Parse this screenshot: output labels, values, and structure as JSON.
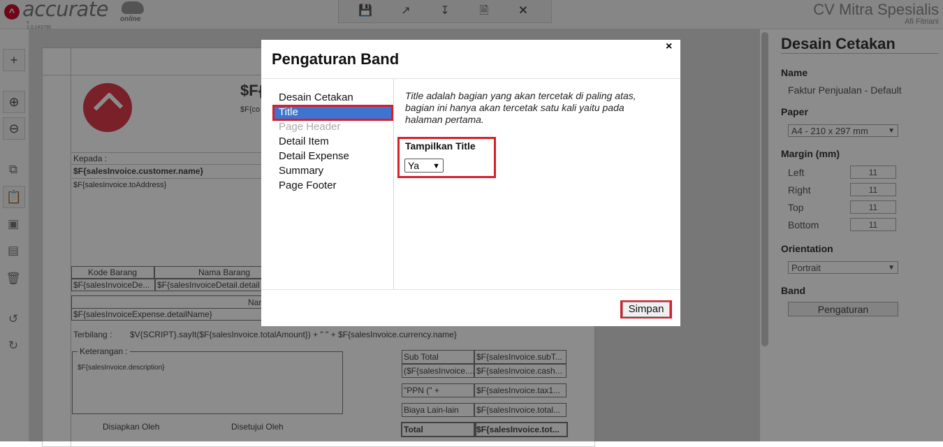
{
  "app": {
    "logo_text": "accurate",
    "logo_sub": "online",
    "version": "v 1.0.1#3790",
    "company": "CV Mitra Spesialis",
    "user": "Afi Fitriani"
  },
  "toolbar_icons": [
    "save-icon",
    "export-icon",
    "download-icon",
    "preview-icon",
    "close-icon"
  ],
  "left_toolbar_icons": [
    "plus-icon",
    "zoom-in-icon",
    "zoom-out-icon",
    "copy-icon",
    "paste-icon",
    "bring-front-icon",
    "send-back-icon",
    "delete-icon",
    "undo-icon",
    "redo-icon"
  ],
  "report": {
    "title_partial": "$F{",
    "subtitle_partial": "$F{co",
    "kepada_label": "Kepada :",
    "customer_name": "$F{salesInvoice.customer.name}",
    "to_address": "$F{salesInvoice.toAddress}",
    "col_kode": "Kode Barang",
    "col_nama": "Nama Barang",
    "cell_kode": "$F{salesInvoiceDe...",
    "cell_nama": "$F{salesInvoiceDetail.detail",
    "expense_header": "Nar",
    "expense_cell": "$F{salesInvoiceExpense.detailName}",
    "terbilang_label": "Terbilang :",
    "terbilang_value": "$V{SCRIPT}.sayIt($F{salesInvoice.totalAmount}) + \" \" + $F{salesInvoice.currency.name}",
    "keterangan_label": "Keterangan :",
    "keterangan_value": "$F{salesInvoice.description}",
    "disiapkan": "Disiapkan Oleh",
    "disetujui": "Disetujui Oleh",
    "summary": [
      {
        "label": "Sub Total",
        "value": "$F{salesInvoice.subT..."
      },
      {
        "label": "($F{salesInvoice....",
        "value": "$F{salesInvoice.cash..."
      },
      {
        "label": "\"PPN (\" +",
        "value": "$F{salesInvoice.tax1..."
      },
      {
        "label": "Biaya Lain-lain",
        "value": "$F{salesInvoice.total..."
      },
      {
        "label": "Total",
        "value": "$F{salesInvoice.tot..."
      }
    ]
  },
  "right_panel": {
    "title": "Desain Cetakan",
    "name_label": "Name",
    "name_value": "Faktur Penjualan - Default",
    "paper_label": "Paper",
    "paper_value": "A4 - 210 x 297 mm",
    "margin_label": "Margin (mm)",
    "margins": [
      {
        "label": "Left",
        "value": "11"
      },
      {
        "label": "Right",
        "value": "11"
      },
      {
        "label": "Top",
        "value": "11"
      },
      {
        "label": "Bottom",
        "value": "11"
      }
    ],
    "orientation_label": "Orientation",
    "orientation_value": "Portrait",
    "band_label": "Band",
    "band_button": "Pengaturan"
  },
  "modal": {
    "title": "Pengaturan Band",
    "close": "×",
    "nav": [
      {
        "label": "Desain Cetakan",
        "state": "normal"
      },
      {
        "label": "Title",
        "state": "selected"
      },
      {
        "label": "Page Header",
        "state": "disabled"
      },
      {
        "label": "Detail Item",
        "state": "normal"
      },
      {
        "label": "Detail Expense",
        "state": "normal"
      },
      {
        "label": "Summary",
        "state": "normal"
      },
      {
        "label": "Page Footer",
        "state": "normal"
      }
    ],
    "description": "Title adalah bagian yang akan tercetak di paling atas, bagian ini hanya akan tercetak satu kali yaitu pada halaman pertama.",
    "field_label": "Tampilkan Title",
    "field_value": "Ya",
    "save_button": "Simpan"
  },
  "colors": {
    "highlight": "#d81e2b",
    "selected_nav": "#3d74d0",
    "brand": "#c8102e"
  }
}
